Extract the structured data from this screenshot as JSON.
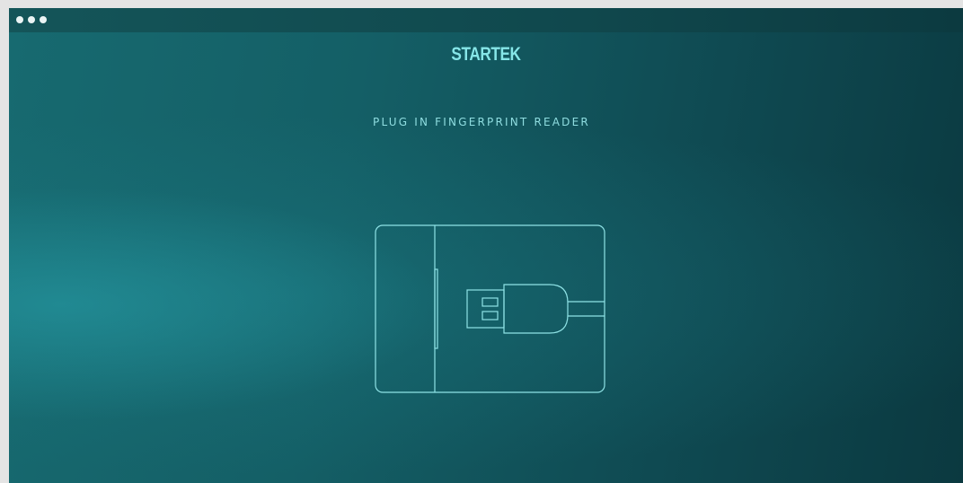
{
  "window": {
    "controls": [
      "dot",
      "dot",
      "dot"
    ]
  },
  "brand": {
    "name": "STARTEK"
  },
  "prompt": {
    "message": "PLUG IN FINGERPRINT READER"
  },
  "illustration": {
    "icon": "usb-plug-in-icon",
    "stroke_color": "#8fe3e6"
  },
  "colors": {
    "accent": "#86e6e8",
    "background_dark": "#0b3940",
    "background_light": "#176a70"
  }
}
